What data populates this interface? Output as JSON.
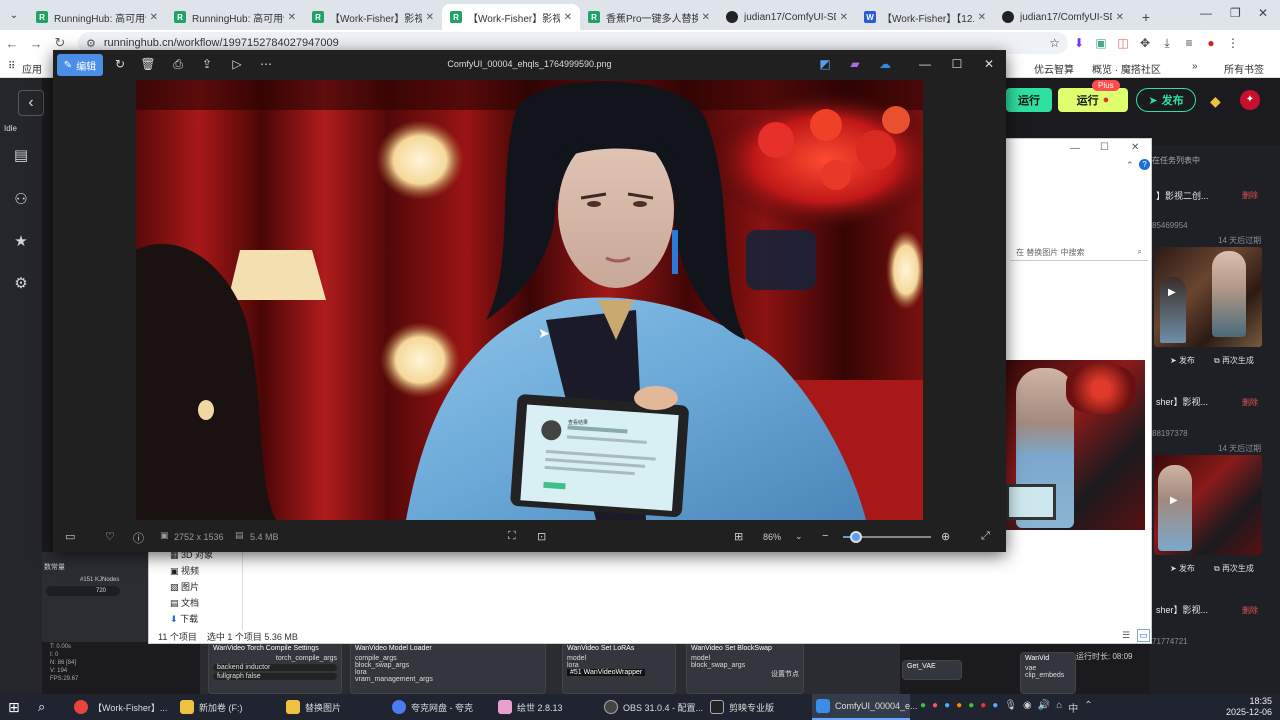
{
  "browser": {
    "tabs": [
      {
        "label": "RunningHub: 高可用性",
        "favicon": "R"
      },
      {
        "label": "RunningHub: 高可用性",
        "favicon": "R"
      },
      {
        "label": "【Work-Fisher】影视二创",
        "favicon": "R"
      },
      {
        "label": "【Work-Fisher】影视二创",
        "favicon": "R",
        "active": true
      },
      {
        "label": "香蕉Pro一键多人替换",
        "favicon": "R"
      },
      {
        "label": "judian17/ComfyUI-SDP",
        "favicon": "gh"
      },
      {
        "label": "【Work-Fisher】【12.0",
        "favicon": "W"
      },
      {
        "label": "judian17/ComfyUI-SDP",
        "favicon": "gh"
      }
    ],
    "new_tab": "+",
    "url": "runninghub.cn/workflow/1997152784027947009",
    "bookmarks": {
      "apps": "应用",
      "bm1": "优云智算",
      "bm2": "概览 · 魔搭社区",
      "more": "»",
      "all": "所有书签"
    }
  },
  "app": {
    "back": "‹",
    "status": "Idle",
    "run_label": "运行",
    "run_plus_label": "运行",
    "plus_badge": "Plus",
    "publish": "发布",
    "queue_text": "在任务列表中",
    "tasks": [
      {
        "title": "】影视二创...",
        "id": "85469954",
        "expire": "14 天后过期",
        "publish": "发布",
        "regen": "再次生成",
        "delete": "删除"
      },
      {
        "title": "sher】影视...",
        "id": "88197378",
        "expire": "14 天后过期",
        "publish": "发布",
        "regen": "再次生成",
        "delete": "删除"
      },
      {
        "title": "sher】影视...",
        "id": "71774721",
        "expire": "",
        "publish": "",
        "regen": "",
        "delete": "删除"
      }
    ],
    "run_time": "运行时长: 08:09",
    "node_labels": [
      "#151 KJNodes",
      "数常量",
      "720"
    ],
    "stats": [
      "T: 0.00s",
      "I: 0",
      "N: 86 [84]",
      "V: 194",
      "FPS:29.67"
    ],
    "nodes": [
      {
        "title": "WanVideo Torch Compile Settings",
        "rows": [
          "torch_compile_args",
          "backend  inductor",
          "fullgraph  false"
        ]
      },
      {
        "title": "WanVideo Model Loader",
        "rows": [
          "compile_args",
          "block_swap_args",
          "lora",
          "vram_management_args"
        ]
      },
      {
        "title": "WanVideo Set LoRAs",
        "rows": [
          "model",
          "lora",
          "#51 WanVideoWrapper"
        ]
      },
      {
        "title": "WanVideo Set BlockSwap",
        "rows": [
          "model",
          "block_swap_args",
          "设置节点"
        ]
      },
      {
        "title": "Get_VAE",
        "rows": []
      },
      {
        "title": "WanVid",
        "rows": [
          "vae",
          "clip_embeds"
        ]
      }
    ]
  },
  "explorer": {
    "search_placeholder": "在 替换图片 中搜索",
    "tree": [
      "3D 对象",
      "视频",
      "图片",
      "文档",
      "下载"
    ],
    "status_count": "11 个项目",
    "status_selected": "选中 1 个项目  5.36 MB"
  },
  "viewer": {
    "edit_label": "编辑",
    "filename": "ComfyUI_00004_ehqls_1764999590.png",
    "dimensions": "2752 x 1536",
    "size": "5.4 MB",
    "zoom": "86%",
    "zoom_fraction": 0.15,
    "tablet_text": "查看结果"
  },
  "taskbar": {
    "items": [
      {
        "label": "【Work-Fisher】...",
        "color": "#e8443a"
      },
      {
        "label": "新加卷 (F:)",
        "color": "#f0c040"
      },
      {
        "label": "替换图片",
        "color": "#f0c040"
      },
      {
        "label": "夸克网盘 - 夸克",
        "color": "#4a7cf0"
      },
      {
        "label": "绘世 2.8.13",
        "color": "#e9a0d0"
      },
      {
        "label": "OBS 31.0.4 - 配置...",
        "color": "#444"
      },
      {
        "label": "剪映专业版",
        "color": "#222"
      },
      {
        "label": "ComfyUI_00004_e...",
        "color": "#3b8ee8"
      }
    ],
    "tray": "中",
    "time": "18:35",
    "date": "2025-12-06"
  }
}
